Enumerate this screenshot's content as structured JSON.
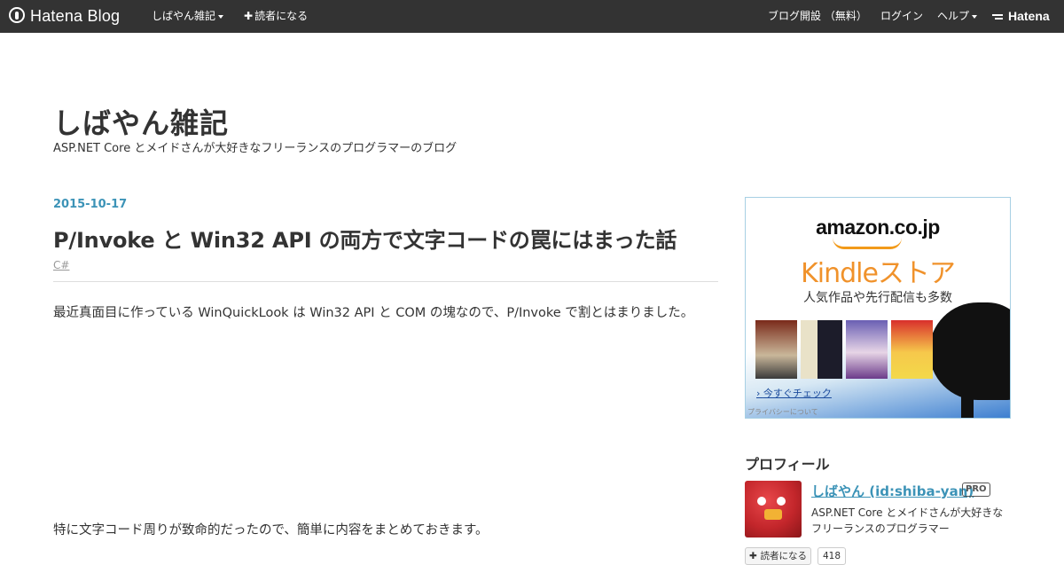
{
  "topbar": {
    "logo_text": "Hatena Blog",
    "blog_menu": "しばやん雑記",
    "subscribe": "読者になる",
    "create_blog": "ブログ開設 （無料）",
    "login": "ログイン",
    "help": "ヘルプ",
    "hatena": "Hatena"
  },
  "blog": {
    "title": "しばやん雑記",
    "description": "ASP.NET Core とメイドさんが大好きなフリーランスのプログラマーのブログ"
  },
  "entry": {
    "date": "2015-10-17",
    "title": "P/Invoke と Win32 API の両方で文字コードの罠にはまった話",
    "category": "C#",
    "paragraph1": "最近真面目に作っている WinQuickLook は Win32 API と COM の塊なので、P/Invoke で割とはまりました。",
    "paragraph2": "特に文字コード周りが致命的だったので、簡単に内容をまとめておきます。"
  },
  "ad": {
    "brand": "amazon.co.jp",
    "store": "Kindleストア",
    "tagline": "人気作品や先行配信も多数",
    "cta": "今すぐチェック",
    "privacy": "プライバシーについて"
  },
  "profile": {
    "heading": "プロフィール",
    "name": "しばやん (id:shiba-yan)",
    "badge": "PRO",
    "description": "ASP.NET Core とメイドさんが大好きなフリーランスのプログラマー",
    "subscribe_label": "読者になる",
    "subscriber_count": "418"
  },
  "colors": {
    "topbar_bg": "#333333",
    "accent": "#3c93b7",
    "kindle_orange": "#f0922b"
  }
}
